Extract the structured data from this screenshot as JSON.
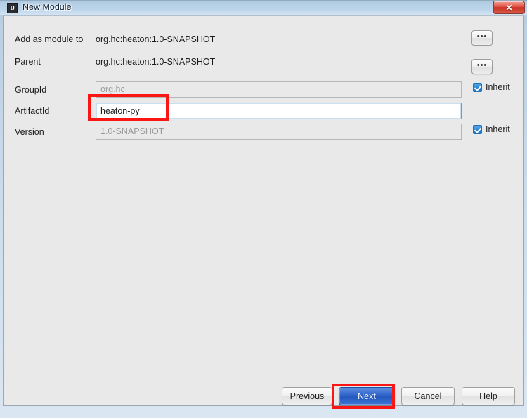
{
  "window": {
    "title": "New Module",
    "app_icon": "IJ",
    "close_label": "✕"
  },
  "form": {
    "add_as_module_to": {
      "label": "Add as module to",
      "value": "org.hc:heaton:1.0-SNAPSHOT",
      "browse_label": "•••"
    },
    "parent": {
      "label": "Parent",
      "value": "org.hc:heaton:1.0-SNAPSHOT",
      "browse_label": "•••"
    },
    "group_id": {
      "label": "GroupId",
      "value": "org.hc",
      "inherit_label": "Inherit",
      "inherit_checked": true
    },
    "artifact_id": {
      "label": "ArtifactId",
      "value": "heaton-py"
    },
    "version": {
      "label": "Version",
      "value": "1.0-SNAPSHOT",
      "inherit_label": "Inherit",
      "inherit_checked": true
    }
  },
  "buttons": {
    "previous": {
      "before": "",
      "mnemonic": "P",
      "after": "revious"
    },
    "next": {
      "before": "",
      "mnemonic": "N",
      "after": "ext"
    },
    "cancel": {
      "label": "Cancel"
    },
    "help": {
      "label": "Help"
    }
  },
  "colors": {
    "annotation": "#fb1616",
    "default_button": "#2f62c8",
    "checkbox": "#2e87d6"
  }
}
